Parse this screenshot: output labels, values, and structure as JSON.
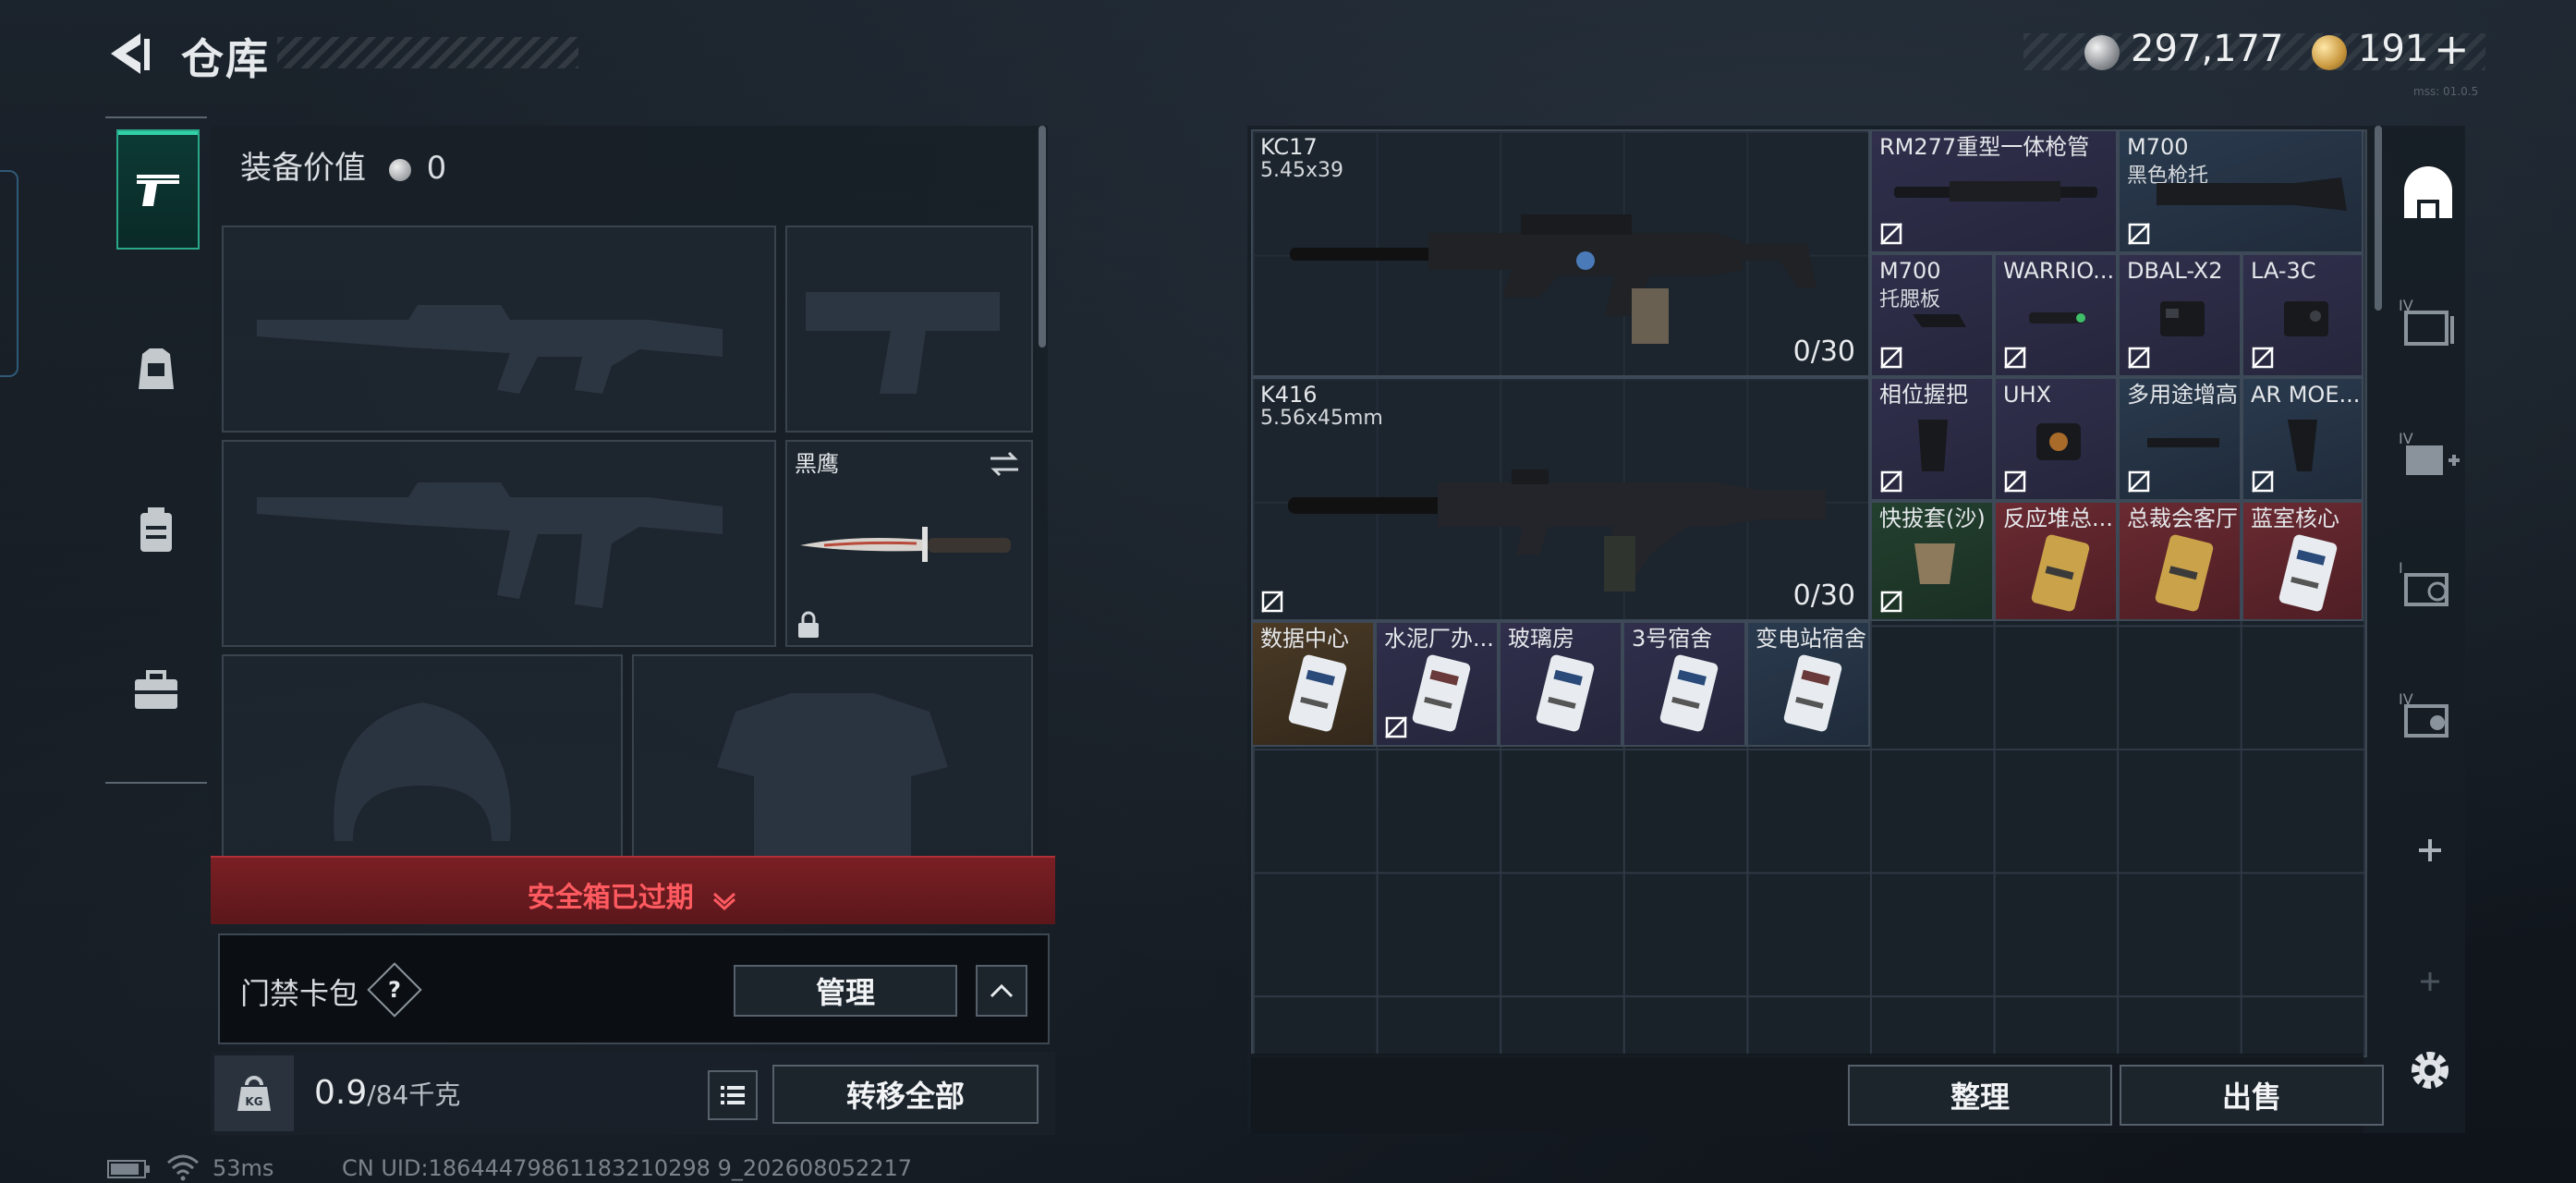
{
  "header": {
    "title": "仓库",
    "currency_silver": "297,177",
    "currency_gold": "191",
    "gold_plus": "+",
    "small_tag": "mss: 01.0.5"
  },
  "loadout": {
    "equip_value_label": "装备价值",
    "equip_value": "0",
    "melee_name": "黑鹰",
    "safe_box_status": "安全箱已过期",
    "card_pack_label": "门禁卡包",
    "help_symbol": "?",
    "manage_label": "管理",
    "weight_value": "0.9",
    "weight_capacity": "/84千克",
    "transfer_all_label": "转移全部",
    "weight_badge": "KG"
  },
  "inventory": {
    "weapons": [
      {
        "name": "KC17",
        "caliber": "5.45x39",
        "ammo": "0/30"
      },
      {
        "name": "K416",
        "caliber": "5.56x45mm",
        "ammo": "0/30"
      }
    ],
    "items": [
      {
        "name": "RM277重型一体枪管",
        "sub": ""
      },
      {
        "name": "M700",
        "sub": "黑色枪托"
      },
      {
        "name": "M700",
        "sub": "托腮板"
      },
      {
        "name": "WARRIO...",
        "sub": ""
      },
      {
        "name": "DBAL-X2",
        "sub": ""
      },
      {
        "name": "LA-3C",
        "sub": ""
      },
      {
        "name": "相位握把",
        "sub": ""
      },
      {
        "name": "UHX",
        "sub": ""
      },
      {
        "name": "多用途增高",
        "sub": ""
      },
      {
        "name": "AR MOE...",
        "sub": ""
      },
      {
        "name": "快拔套(沙)",
        "sub": ""
      },
      {
        "name": "反应堆总...",
        "sub": ""
      },
      {
        "name": "总裁会客厅",
        "sub": ""
      },
      {
        "name": "蓝室核心",
        "sub": ""
      },
      {
        "name": "数据中心",
        "sub": ""
      },
      {
        "name": "水泥厂办...",
        "sub": ""
      },
      {
        "name": "玻璃房",
        "sub": ""
      },
      {
        "name": "3号宿舍",
        "sub": ""
      },
      {
        "name": "变电站宿舍",
        "sub": ""
      }
    ],
    "sort_label": "整理",
    "sell_label": "出售"
  },
  "status_bar": {
    "ping": "53ms",
    "uid": "CN UID:18644479861183210298 9_202608052217"
  }
}
